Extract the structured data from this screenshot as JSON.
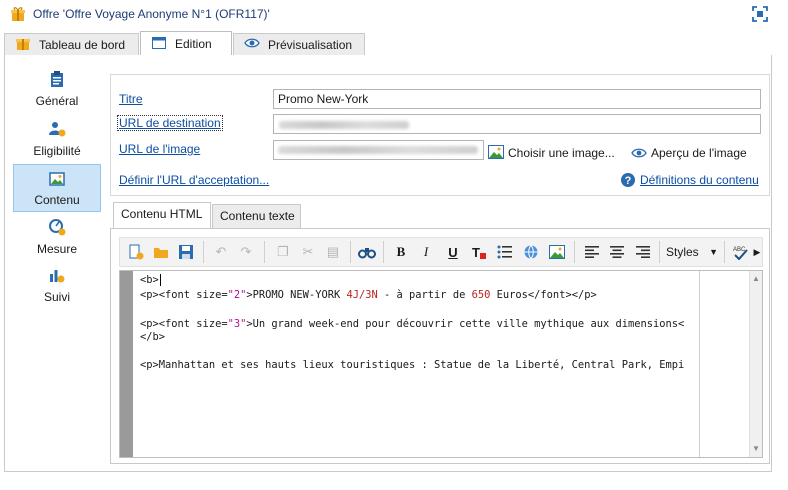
{
  "window": {
    "title": "Offre 'Offre Voyage Anonyme N°1 (OFR117)'"
  },
  "top_tabs": [
    {
      "label": "Tableau de bord"
    },
    {
      "label": "Edition"
    },
    {
      "label": "Prévisualisation"
    }
  ],
  "nav": [
    {
      "label": "Général"
    },
    {
      "label": "Eligibilité"
    },
    {
      "label": "Contenu"
    },
    {
      "label": "Mesure"
    },
    {
      "label": "Suivi"
    }
  ],
  "form": {
    "titre_label": "Titre",
    "titre_value": "Promo New-York",
    "url_dest_label": "URL de destination",
    "url_image_label": "URL de l'image",
    "choose_image": "Choisir une image...",
    "preview_image": "Aperçu de l'image",
    "accept_url": "Définir l'URL d'acceptation...",
    "content_defs": "Définitions du contenu"
  },
  "content_tabs": [
    {
      "label": "Contenu HTML"
    },
    {
      "label": "Contenu texte"
    }
  ],
  "toolbar": {
    "styles_label": "Styles"
  },
  "code": {
    "l1": "<b>",
    "l2a": "<p><font size=",
    "l2b": "\"2\"",
    "l2c": ">PROMO NEW-YORK ",
    "l2d": "4J/3N",
    "l2e": " - à partir de ",
    "l2f": "650",
    "l2g": " Euros</font></p>",
    "l3a": "<p><font size=",
    "l3b": "\"3\"",
    "l3c": ">Un grand week-end pour découvrir cette ville mythique aux dimensions<",
    "l4": "</b>",
    "l5": "<p>Manhattan et ses hauts lieux touristiques : Statue de la Liberté, Central Park, Empi"
  },
  "colors": {
    "accent": "#0b4ea2",
    "active_nav": "#cce4f7",
    "code_number": "#c02020",
    "code_string": "#b0108a"
  }
}
